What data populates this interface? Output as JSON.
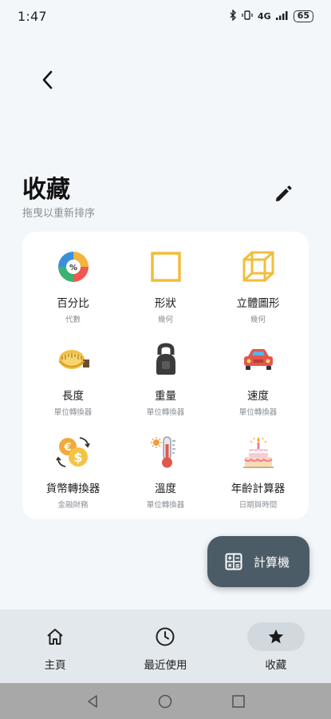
{
  "status_bar": {
    "time": "1:47",
    "network": "4G",
    "battery": "65"
  },
  "header": {
    "title": "收藏",
    "subtitle": "拖曳以重新排序"
  },
  "favorites": [
    {
      "name": "百分比",
      "category": "代數",
      "icon": "percentage-pie-icon"
    },
    {
      "name": "形狀",
      "category": "幾何",
      "icon": "square-shape-icon"
    },
    {
      "name": "立體圖形",
      "category": "幾何",
      "icon": "cube-icon"
    },
    {
      "name": "長度",
      "category": "單位轉換器",
      "icon": "tape-measure-icon"
    },
    {
      "name": "重量",
      "category": "單位轉換器",
      "icon": "kettlebell-icon"
    },
    {
      "name": "速度",
      "category": "單位轉換器",
      "icon": "car-icon"
    },
    {
      "name": "貨幣轉換器",
      "category": "金融財務",
      "icon": "currency-exchange-icon"
    },
    {
      "name": "溫度",
      "category": "單位轉換器",
      "icon": "thermometer-icon"
    },
    {
      "name": "年齡計算器",
      "category": "日期與時間",
      "icon": "birthday-cake-icon"
    }
  ],
  "fab": {
    "label": "計算機",
    "icon": "calculator-icon"
  },
  "bottom_nav": [
    {
      "label": "主頁",
      "icon": "home-icon",
      "active": false
    },
    {
      "label": "最近使用",
      "icon": "clock-icon",
      "active": false
    },
    {
      "label": "收藏",
      "icon": "star-icon",
      "active": true
    }
  ],
  "colors": {
    "background": "#f3f7fa",
    "card": "#ffffff",
    "fab": "#4c5c66",
    "nav_bar": "#e3e8ec",
    "active_pill": "#d2d9de",
    "shape_yellow": "#f2bd3c"
  }
}
